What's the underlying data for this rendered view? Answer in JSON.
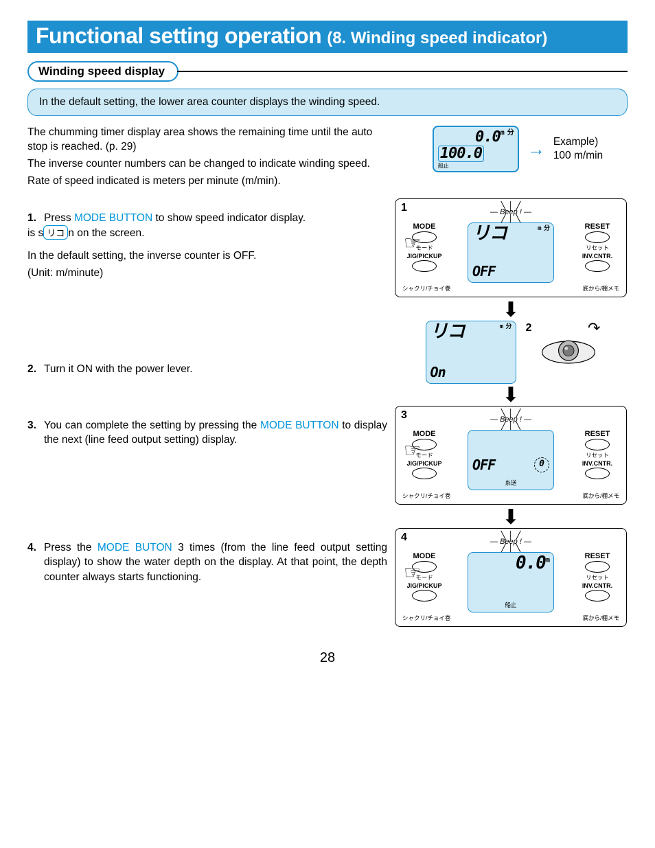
{
  "title": {
    "main": "Functional setting operation",
    "sub": "(8. Winding speed indicator)"
  },
  "section_heading": "Winding speed display",
  "info_box": "In the default setting, the lower area counter displays the winding speed.",
  "intro": {
    "l1": "The chumming timer display area shows the remaining time until the auto stop is reached. (p. 29)",
    "l2": "The inverse counter numbers can be changed to indicate  winding speed.",
    "l3": "Rate of speed indicated is meters per minute (m/min)."
  },
  "example": {
    "lcd_top": "0.0",
    "lcd_top_unit": "m 分",
    "lcd_bottom": "100.0",
    "lcd_foot": "船止",
    "label_a": "Example)",
    "label_b": "100 m/min"
  },
  "steps": {
    "s1": {
      "num": "1.",
      "text_a": "Press ",
      "btn": "MODE BUTTON",
      "text_b": " to show speed indicator display.",
      "line2_a": "is shown on the screen.",
      "circled": "リコ",
      "note_a": "In the default setting, the inverse counter is OFF.",
      "note_b": "(Unit: m/minute)"
    },
    "s2": {
      "num": "2.",
      "text": "Turn it ON with the power lever."
    },
    "s3": {
      "num": "3.",
      "text_a": "You can complete the setting by pressing the ",
      "btn": "MODE BUTTON",
      "text_b": "to display the next (line feed output setting) display."
    },
    "s4": {
      "num": "4.",
      "text_a": "Press the ",
      "btn": "MODE BUTON",
      "text_b": " 3 times (from the line feed output setting display) to show the water depth on the display. At that point, the depth counter always starts functioning."
    }
  },
  "panel_common": {
    "beep": "Beep !",
    "mode": "MODE",
    "mode_jp": "モード",
    "jig": "JIG/PICKUP",
    "jig_jp": "シャクリ/チョイ巻",
    "reset": "RESET",
    "reset_jp": "リセット",
    "inv": "INV.CNTR.",
    "inv_jp": "底から/棚メモ"
  },
  "panel1": {
    "badge": "1",
    "lcd_big": "リコ",
    "lcd_unit": "m\n分",
    "lcd_sub": "OFF"
  },
  "panel2": {
    "badge": "2",
    "lcd_big": "リコ",
    "lcd_unit": "m\n分",
    "lcd_sub": "On"
  },
  "panel3": {
    "badge": "3",
    "lcd_sub": "OFF",
    "lcd_foot": "糸送",
    "circ": "0"
  },
  "panel4": {
    "badge": "4",
    "lcd_big": "0.0",
    "lcd_unit": "m",
    "lcd_foot": "船止"
  },
  "page_number": "28"
}
